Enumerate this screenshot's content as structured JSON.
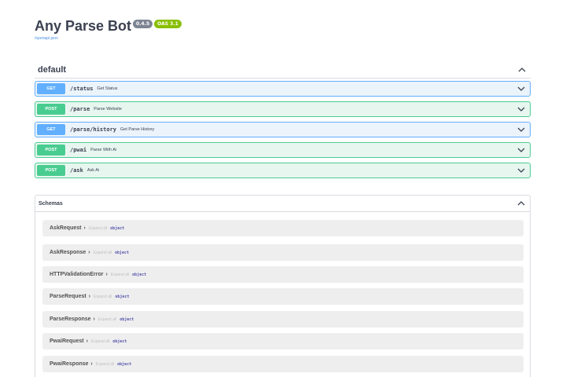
{
  "header": {
    "title": "Any Parse Bot",
    "version_badge": "0.4.5",
    "oas_badge": "OAS 3.1",
    "spec_link": "/openapi.json"
  },
  "section": {
    "title": "default",
    "toggle_icon": "chevron-up-icon"
  },
  "operations": [
    {
      "method": "GET",
      "path": "/status",
      "summary": "Get Status"
    },
    {
      "method": "POST",
      "path": "/parse",
      "summary": "Parse Website"
    },
    {
      "method": "GET",
      "path": "/parse/history",
      "summary": "Get Parse History"
    },
    {
      "method": "POST",
      "path": "/pwai",
      "summary": "Parse With Ai"
    },
    {
      "method": "POST",
      "path": "/ask",
      "summary": "Ask Ai"
    }
  ],
  "schemas": {
    "title": "Schemas",
    "items": [
      {
        "name": "AskRequest",
        "expand": "Expand all",
        "type": "object"
      },
      {
        "name": "AskResponse",
        "expand": "Expand all",
        "type": "object"
      },
      {
        "name": "HTTPValidationError",
        "expand": "Expand all",
        "type": "object"
      },
      {
        "name": "ParseRequest",
        "expand": "Expand all",
        "type": "object"
      },
      {
        "name": "ParseResponse",
        "expand": "Expand all",
        "type": "object"
      },
      {
        "name": "PwaiRequest",
        "expand": "Expand all",
        "type": "object"
      },
      {
        "name": "PwaiResponse",
        "expand": "Expand all",
        "type": "object"
      }
    ]
  },
  "colors": {
    "get": "#61affe",
    "post": "#49cc90",
    "get_bg": "#ebf3fb",
    "post_bg": "#e8f6f0",
    "oas_badge": "#89bf04",
    "version_badge": "#7d8492"
  }
}
